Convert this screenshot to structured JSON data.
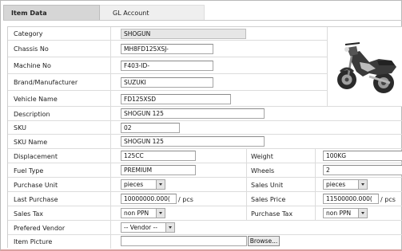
{
  "tabs": {
    "item_data": "Item Data",
    "gl_account": "GL Account"
  },
  "fields": {
    "category": {
      "label": "Category",
      "value": "SHOGUN"
    },
    "chassis_no": {
      "label": "Chassis No",
      "value": "MH8FD125XSJ-"
    },
    "machine_no": {
      "label": "Machine No",
      "value": "F403-ID-"
    },
    "brand": {
      "label": "Brand/Manufacturer",
      "value": "SUZUKI"
    },
    "vehicle_name": {
      "label": "Vehicle Name",
      "value": "FD125XSD"
    },
    "description": {
      "label": "Description",
      "value": "SHOGUN 125"
    },
    "sku": {
      "label": "SKU",
      "value": "02"
    },
    "sku_name": {
      "label": "SKU Name",
      "value": "SHOGUN 125"
    },
    "displacement": {
      "label": "Displacement",
      "value": "125CC"
    },
    "weight": {
      "label": "Weight",
      "value": "100KG"
    },
    "fuel_type": {
      "label": "Fuel Type",
      "value": "PREMIUM"
    },
    "wheels": {
      "label": "Wheels",
      "value": "2"
    },
    "purchase_unit": {
      "label": "Purchase Unit",
      "value": "pieces"
    },
    "sales_unit": {
      "label": "Sales Unit",
      "value": "pieces"
    },
    "last_purchase": {
      "label": "Last Purchase",
      "value": "10000000.000(",
      "suffix": "/ pcs"
    },
    "sales_price": {
      "label": "Sales Price",
      "value": "11500000.000(",
      "suffix": "/ pcs"
    },
    "sales_tax": {
      "label": "Sales Tax",
      "value": "non PPN"
    },
    "purchase_tax": {
      "label": "Purchase Tax",
      "value": "non PPN"
    },
    "vendor": {
      "label": "Prefered Vendor",
      "value": "-- Vendor --"
    },
    "item_picture": {
      "label": "Item Picture",
      "value": "",
      "browse_label": "Browse..."
    }
  },
  "colors": {
    "tab_active": "#d6d6d6",
    "readonly_field": "#e6e6e6",
    "frame_bottom": "#d9a0a0"
  },
  "image": {
    "subject": "motorcycle-photo"
  }
}
